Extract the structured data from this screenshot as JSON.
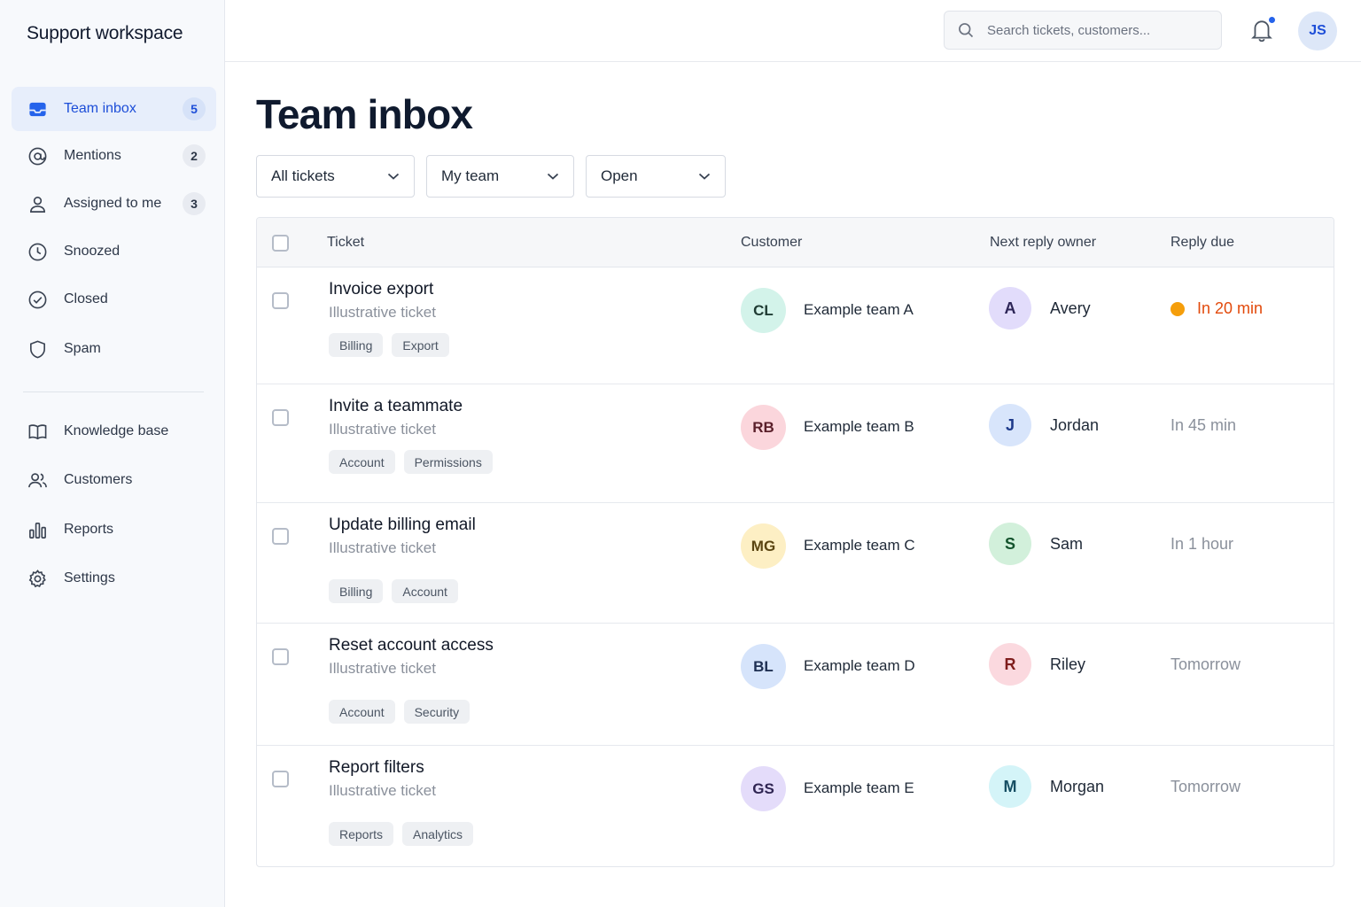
{
  "app": {
    "workspace_title": "Support workspace"
  },
  "sidebar": {
    "items": [
      {
        "label": "Team inbox",
        "count": "5",
        "icon": "inbox-icon"
      },
      {
        "label": "Mentions",
        "count": "2",
        "icon": "at-sign-icon"
      },
      {
        "label": "Assigned to me",
        "count": "3",
        "icon": "user-icon"
      },
      {
        "label": "Snoozed",
        "icon": "clock-icon"
      },
      {
        "label": "Closed",
        "icon": "check-circle-icon"
      },
      {
        "label": "Spam",
        "icon": "shield-icon"
      },
      {
        "label": "Knowledge base",
        "icon": "book-icon"
      },
      {
        "label": "Customers",
        "icon": "users-icon"
      },
      {
        "label": "Reports",
        "icon": "bar-chart-icon"
      },
      {
        "label": "Settings",
        "icon": "gear-icon"
      }
    ],
    "active_index": 0
  },
  "header": {
    "search_placeholder": "Search tickets, customers...",
    "user_initials": "JS",
    "has_notification": true
  },
  "main": {
    "title": "Team inbox",
    "filters": [
      {
        "label": "All tickets"
      },
      {
        "label": "My team"
      },
      {
        "label": "Open"
      }
    ],
    "columns": [
      "Ticket",
      "Customer",
      "Next reply owner",
      "Reply due"
    ],
    "rows": [
      {
        "title": "Invoice export",
        "subtitle": "Illustrative ticket",
        "tags": [
          "Billing",
          "Export"
        ],
        "customer_initials": "CL",
        "customer": "Example team A",
        "owner_initial": "A",
        "owner": "Avery",
        "due": "In 20 min",
        "urgent": true
      },
      {
        "title": "Invite a teammate",
        "subtitle": "Illustrative ticket",
        "tags": [
          "Account",
          "Permissions"
        ],
        "customer_initials": "RB",
        "customer": "Example team B",
        "owner_initial": "J",
        "owner": "Jordan",
        "due": "In 45 min",
        "urgent": false
      },
      {
        "title": "Update billing email",
        "subtitle": "Illustrative ticket",
        "tags": [
          "Billing",
          "Account"
        ],
        "customer_initials": "MG",
        "customer": "Example team C",
        "owner_initial": "S",
        "owner": "Sam",
        "due": "In 1 hour",
        "urgent": false
      },
      {
        "title": "Reset account access",
        "subtitle": "Illustrative ticket",
        "tags": [
          "Account",
          "Security"
        ],
        "customer_initials": "BL",
        "customer": "Example team D",
        "owner_initial": "R",
        "owner": "Riley",
        "due": "Tomorrow",
        "urgent": false
      },
      {
        "title": "Report filters",
        "subtitle": "Illustrative ticket",
        "tags": [
          "Reports",
          "Analytics"
        ],
        "customer_initials": "GS",
        "customer": "Example team E",
        "owner_initial": "M",
        "owner": "Morgan",
        "due": "Tomorrow",
        "urgent": false
      }
    ]
  },
  "colors": {
    "accent": "#1d4ed8",
    "urgent": "#e24a0c",
    "urgent_dot": "#f59e0b",
    "customer_avatars": [
      {
        "bg": "#d3f3ea",
        "fg": "#1f3b33"
      },
      {
        "bg": "#fbd6dc",
        "fg": "#5a1f2a"
      },
      {
        "bg": "#fdefc4",
        "fg": "#5b4512"
      },
      {
        "bg": "#d6e4fb",
        "fg": "#1e2f52"
      },
      {
        "bg": "#e4dcfa",
        "fg": "#2f2552"
      }
    ],
    "owner_avatars": [
      {
        "bg": "#e2dcfb",
        "fg": "#2d2557"
      },
      {
        "bg": "#d8e5fb",
        "fg": "#1e3a8a"
      },
      {
        "bg": "#d2f0db",
        "fg": "#14532d"
      },
      {
        "bg": "#fbd9df",
        "fg": "#7f1d1d"
      },
      {
        "bg": "#d4f4f8",
        "fg": "#164e63"
      }
    ]
  }
}
